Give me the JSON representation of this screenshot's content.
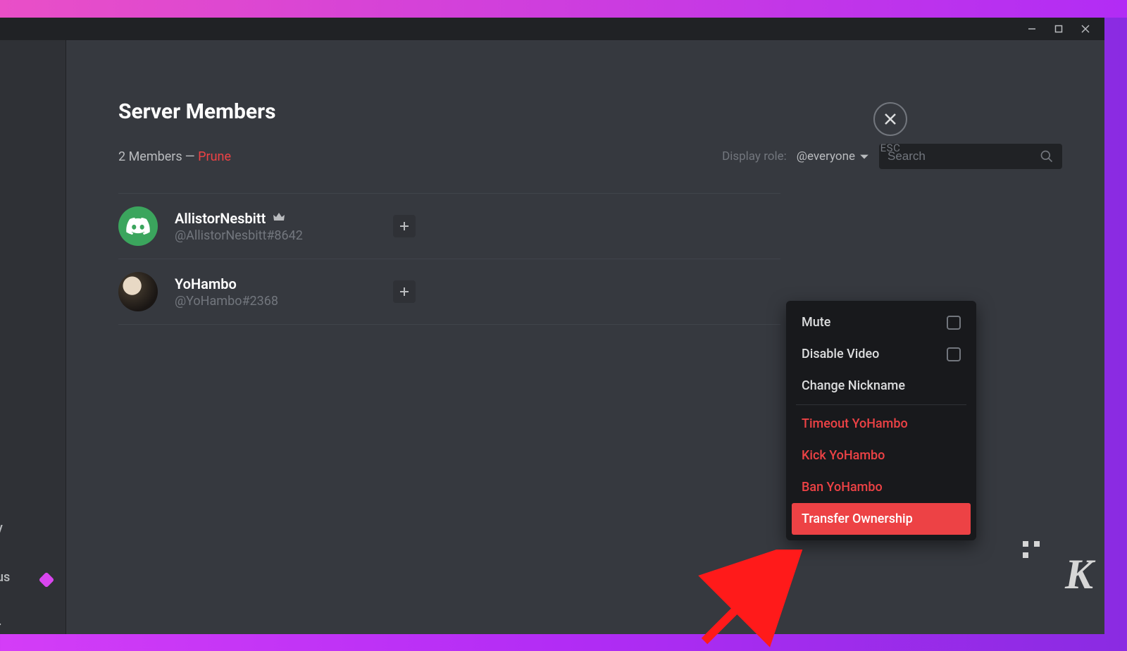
{
  "window": {
    "title": "Server Members"
  },
  "header": {
    "title": "Server Members",
    "member_count": "2 Members",
    "separator": " — ",
    "prune": "Prune",
    "display_role_label": "Display role:",
    "role_selected": "@everyone",
    "search_placeholder": "Search",
    "esc_label": "ESC"
  },
  "members": [
    {
      "name": "AllistorNesbitt",
      "tag": "@AllistorNesbitt#8642",
      "avatar_style": "green-discord",
      "owner": true
    },
    {
      "name": "YoHambo",
      "tag": "@YoHambo#2368",
      "avatar_style": "photo",
      "owner": false
    }
  ],
  "context_menu": {
    "mute": "Mute",
    "disable_video": "Disable Video",
    "change_nickname": "Change Nickname",
    "timeout": "Timeout YoHambo",
    "kick": "Kick YoHambo",
    "ban": "Ban YoHambo",
    "transfer": "Transfer Ownership"
  },
  "sidebar_fragments": {
    "item1": "y",
    "item2": "us",
    "item3": "r"
  },
  "watermark": "K"
}
